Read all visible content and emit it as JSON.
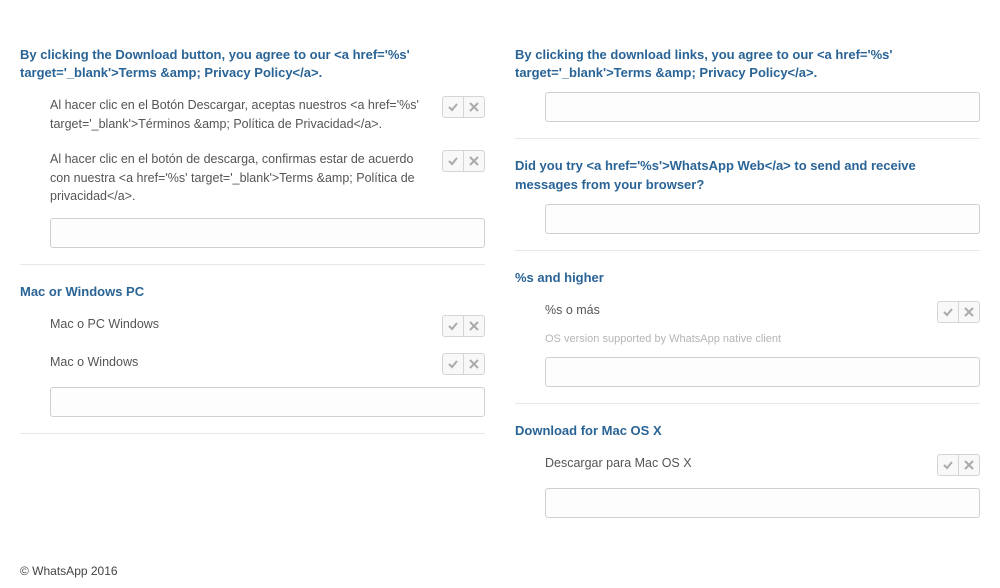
{
  "left": {
    "sections": [
      {
        "header": "By clicking the Download button, you agree to our <a href='%s' target='_blank'>Terms &amp; Privacy Policy</a>.",
        "translations": [
          "Al hacer clic en el Botón Descargar, aceptas nuestros <a href='%s' target='_blank'>Términos &amp; Política de Privacidad</a>.",
          "Al hacer clic en el botón de descarga, confirmas estar de acuerdo con nuestra <a href='%s' target='_blank'>Terms &amp; Política de privacidad</a>."
        ]
      },
      {
        "header": "Mac or Windows PC",
        "translations": [
          "Mac o PC Windows",
          "Mac o Windows"
        ]
      }
    ]
  },
  "right": {
    "sections": [
      {
        "header": "By clicking the download links, you agree to our <a href='%s' target='_blank'>Terms &amp; Privacy Policy</a>.",
        "translations": []
      },
      {
        "header": "Did you try <a href='%s'>WhatsApp Web</a> to send and receive messages from your browser?",
        "translations": []
      },
      {
        "header": "%s and higher",
        "translations": [
          "%s o más"
        ],
        "hint": "OS version supported by WhatsApp native client"
      },
      {
        "header": "Download for Mac OS X",
        "translations": [
          "Descargar para Mac OS X"
        ]
      }
    ]
  },
  "footer": "© WhatsApp 2016"
}
